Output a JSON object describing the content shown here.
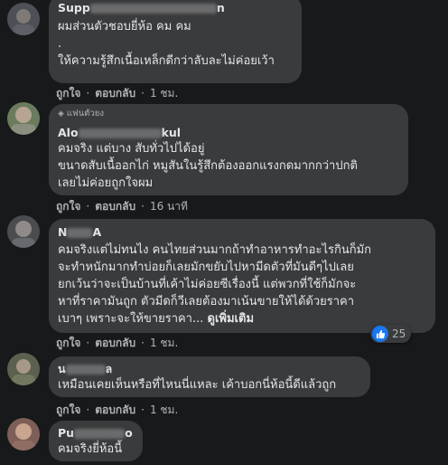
{
  "comments": [
    {
      "name_visible": "Supp",
      "name_tail": "n",
      "lines": [
        "ผมส่วนตัวชอบยี่ห้อ คม คม",
        ".",
        "ให้ความรู้สึกเนื้อเหล็กดีกว่าลับละไม่ค่อยเว้า"
      ],
      "actions": {
        "like": "ถูกใจ",
        "reply": "ตอบกลับ",
        "time": "1 ชม."
      }
    },
    {
      "badge": "แฟนตัวยง",
      "name_visible": "Alo",
      "name_tail": "kul",
      "lines": [
        "คมจริง แต่บาง สับทั่วไปได้อยู่",
        "ขนาดสับเนื้ออกไก่ หมูสันในรู้สึกต้องออกแรงกดมากกว่าปกติ",
        "เลยไม่ค่อยถูกใจผม"
      ],
      "actions": {
        "like": "ถูกใจ",
        "reply": "ตอบกลับ",
        "time": "16 นาที"
      }
    },
    {
      "name_visible": "N",
      "name_tail": "A",
      "lines": [
        "คมจริงแต่ไม่ทนไง คนไทยส่วนมากถ้าทำอาหารทำอะไรกินก็มัก",
        "จะทำหนักมากทำบ่อยก็เลยมักขยับไปหามีดตัวที่มันดีๆไปเลย",
        "ยกเว้นว่าจะเป็นบ้านที่เค้าไม่ค่อยซีเรื่องนี้ แต่พวกที่ใช้ก็มักจะ",
        "หาที่ราคามันถูก ตัวมีดก็วีเลยต้องมาเน้นขายให้ได้ด้วยราคา"
      ],
      "last_line": "เบาๆ เพราะจะให้ขายราคา...",
      "see_more": "ดูเพิ่มเติม",
      "reaction_count": "25",
      "actions": {
        "like": "ถูกใจ",
        "reply": "ตอบกลับ",
        "time": "1 ชม."
      }
    },
    {
      "name_visible": "น",
      "name_tail": "ล",
      "lines": [
        "เหมือนเคยเห็นหรือที่ไหนนี่แหละ เค้าบอกนี่ห้อนี้ดีแล้วถูก"
      ],
      "actions": {
        "like": "ถูกใจ",
        "reply": "ตอบกลับ",
        "time": "1 ชม."
      }
    },
    {
      "name_visible": "Pu",
      "name_tail": "o",
      "lines": [
        "คมจริงยี่ห้อนี้"
      ]
    }
  ],
  "colors": {
    "background": "#18191a",
    "bubble": "#3a3b3c",
    "text": "#e4e6eb",
    "muted": "#b0b3b8",
    "like": "#1877f2"
  }
}
